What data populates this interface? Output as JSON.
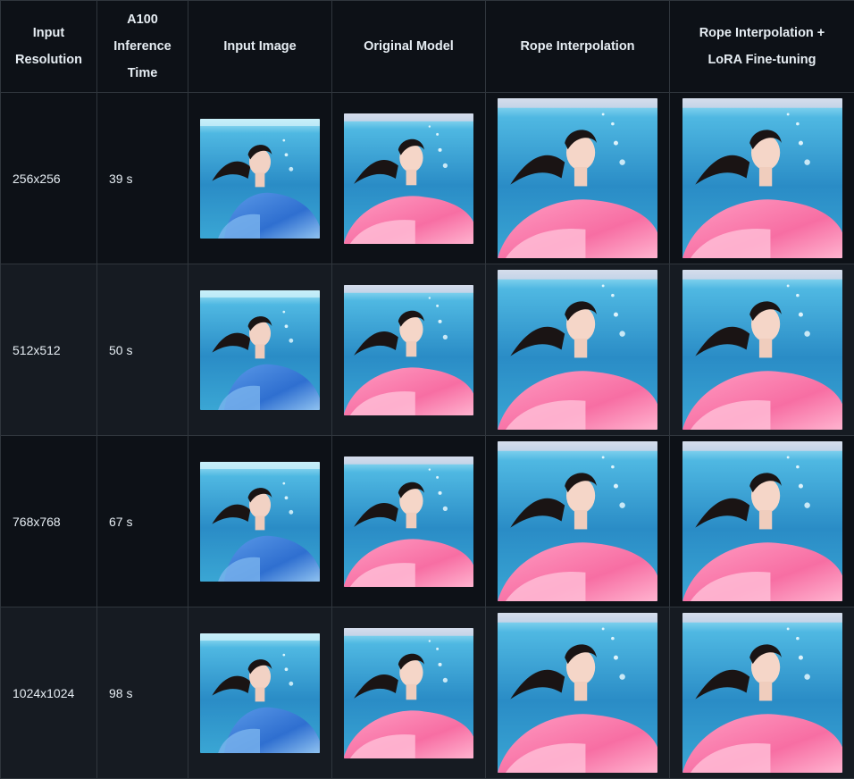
{
  "headers": {
    "resolution_line1": "Input",
    "resolution_line2": "Resolution",
    "time_line1": "A100",
    "time_line2": "Inference",
    "time_line3": "Time",
    "input_image": "Input Image",
    "original_model": "Original Model",
    "rope_interpolation": "Rope Interpolation",
    "rope_lora_line1": "Rope Interpolation +",
    "rope_lora_line2": "LoRA Fine-tuning"
  },
  "rows": [
    {
      "resolution": "256x256",
      "time": "39 s"
    },
    {
      "resolution": "512x512",
      "time": "50 s"
    },
    {
      "resolution": "768x768",
      "time": "67 s"
    },
    {
      "resolution": "1024x1024",
      "time": "98 s"
    }
  ],
  "images": {
    "input": "underwater portrait of a woman in a blue dress",
    "output": "underwater portrait of a woman in a pink dress"
  },
  "colors": {
    "page_bg": "#0d1117",
    "alt_row_bg": "#161b22",
    "border": "#30363d",
    "text": "#e6edf3",
    "water_light": "#7fd3ef",
    "water_dark": "#1b6fa3",
    "dress_blue": "#3d7fd6",
    "dress_pink": "#ff7fb0"
  }
}
